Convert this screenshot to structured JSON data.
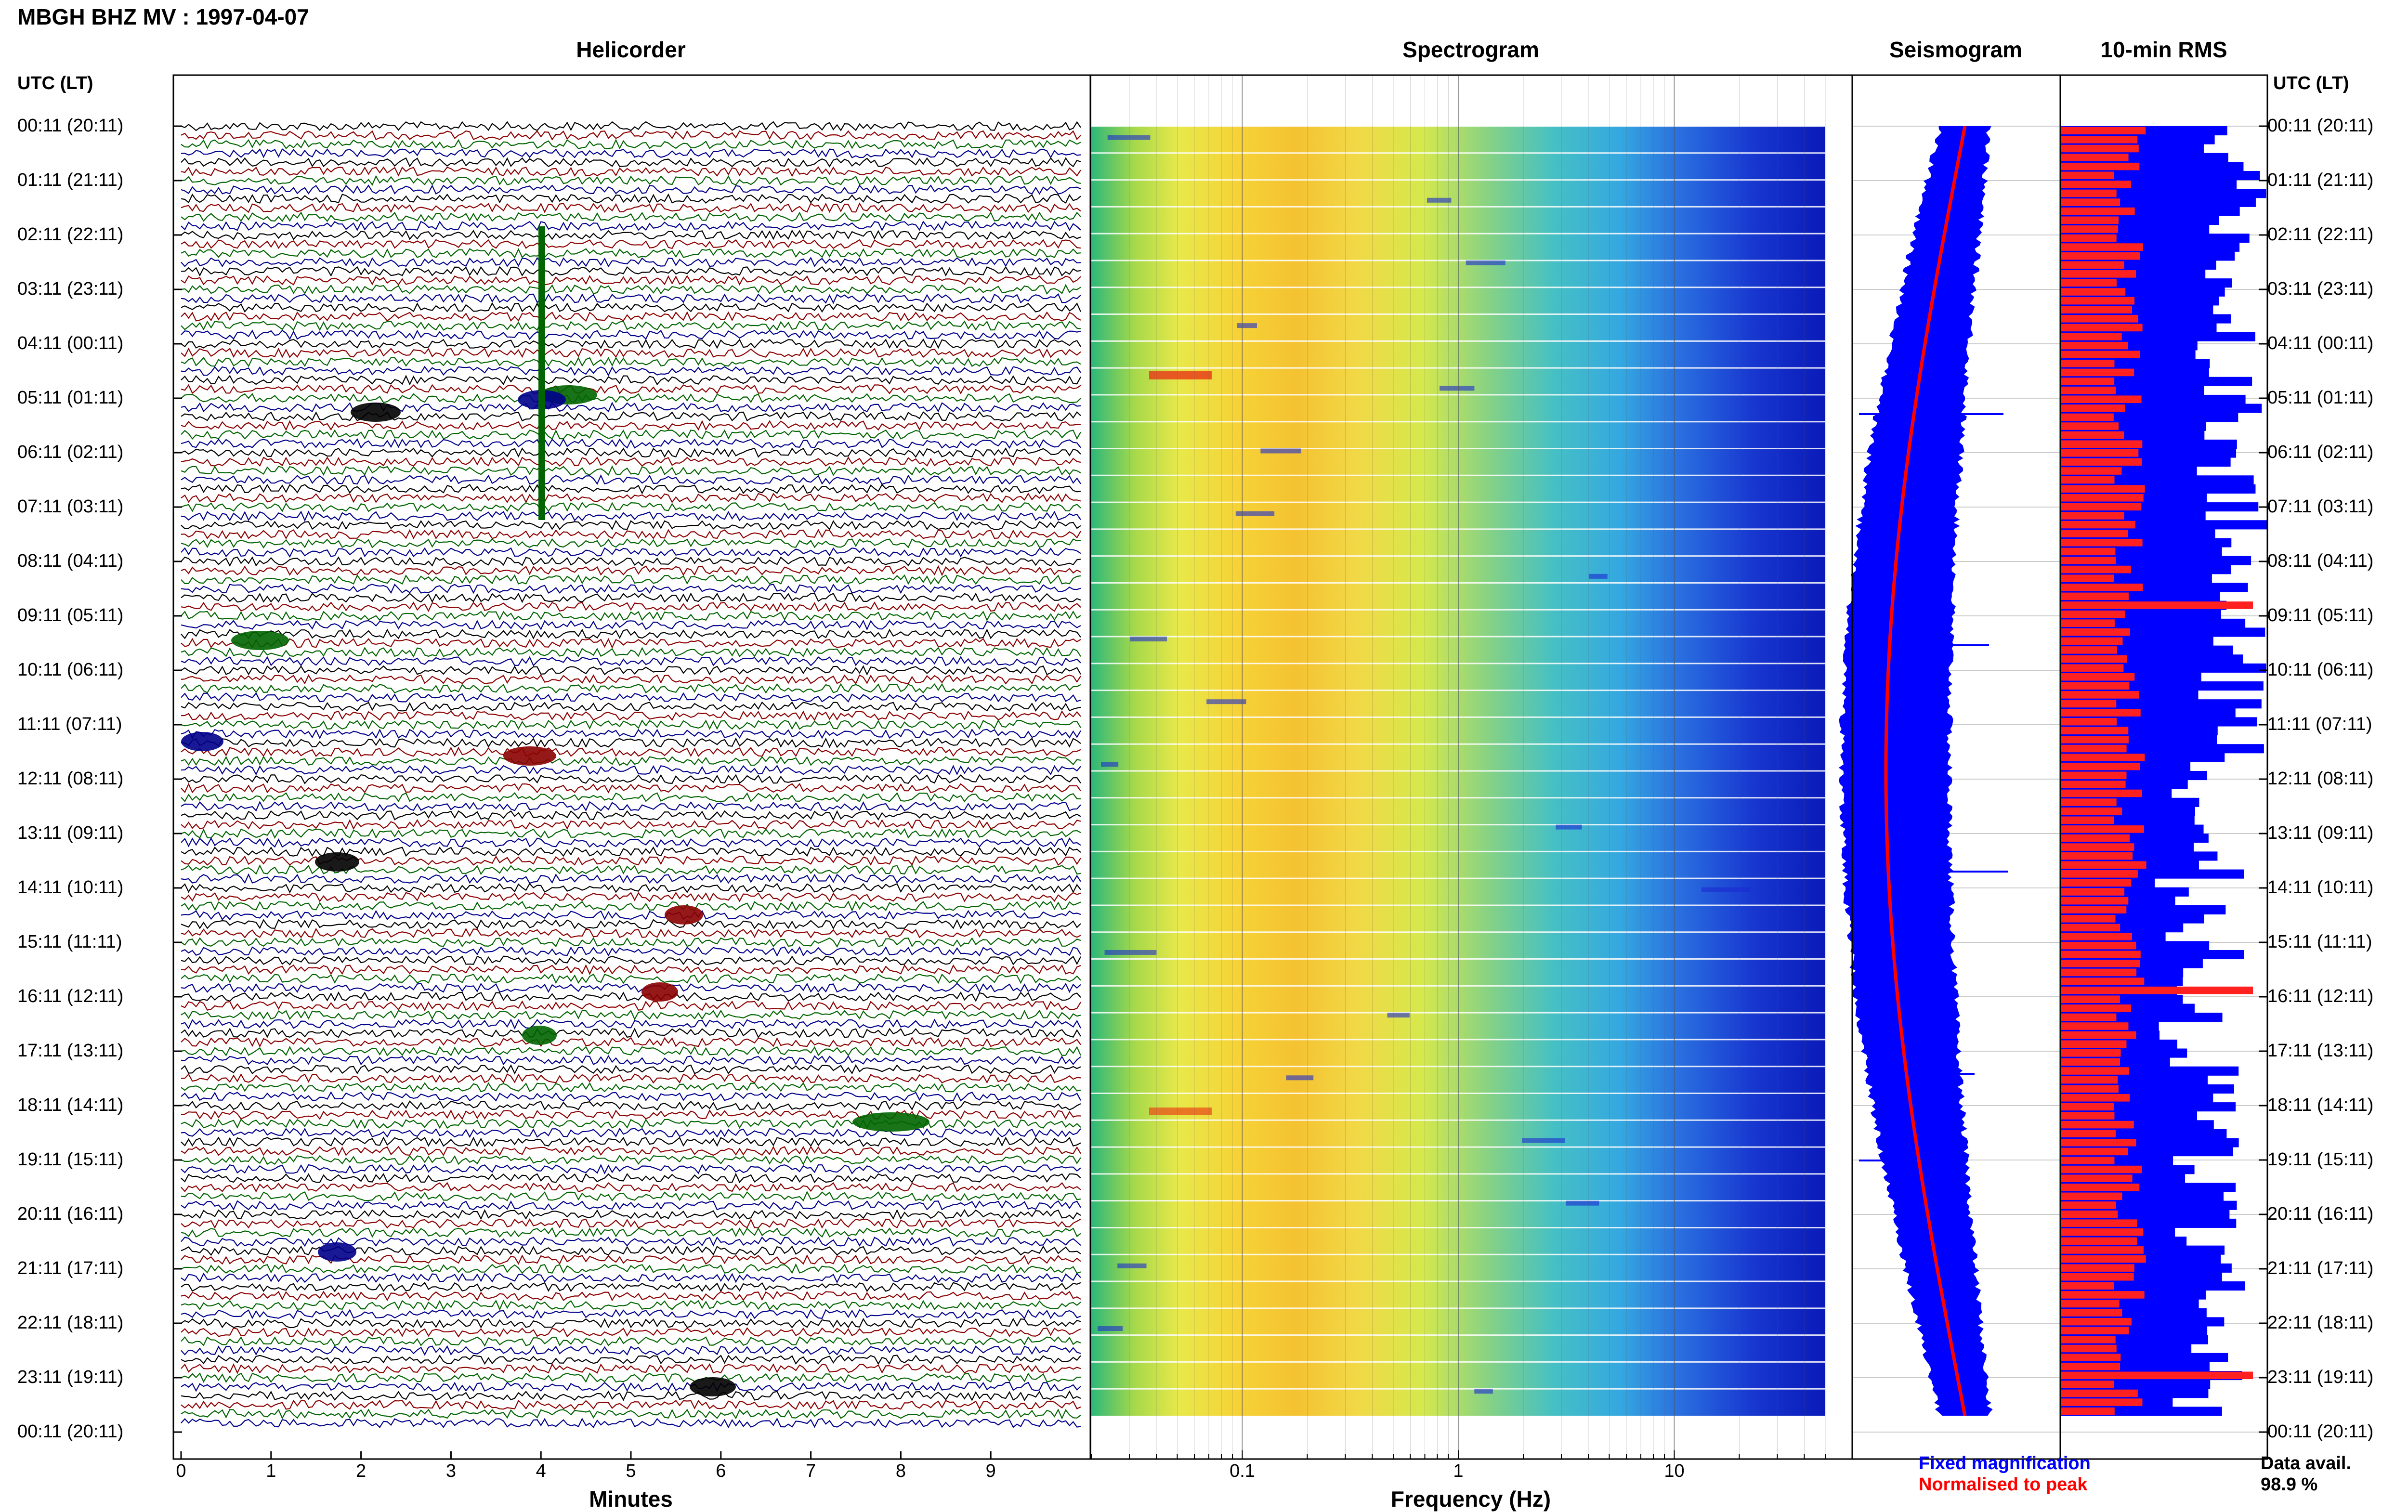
{
  "header": {
    "title": "MBGH BHZ MV : 1997-04-07"
  },
  "panels": {
    "helicorder": {
      "title": "Helicorder",
      "xlabel": "Minutes"
    },
    "spectrogram": {
      "title": "Spectrogram",
      "xlabel": "Frequency (Hz)"
    },
    "seismogram": {
      "title": "Seismogram"
    },
    "rms": {
      "title": "10-min RMS"
    }
  },
  "axis": {
    "left_label": "UTC (LT)",
    "right_label": "UTC (LT)"
  },
  "legend": {
    "fixed": "Fixed magnification",
    "normalised": "Normalised to peak"
  },
  "data_availability": {
    "label": "Data avail.",
    "value": "98.9 %"
  },
  "colors": {
    "trace_colors": [
      "#000000",
      "#cc0000",
      "#00aa00",
      "#0000ff"
    ],
    "helicorder_trace_colors": [
      "#000000",
      "#8b0000",
      "#006400",
      "#00008b"
    ],
    "fixed": "#0000ff",
    "normalised": "#ff0000"
  },
  "chart_data": [
    {
      "type": "line",
      "name": "helicorder",
      "title": "Helicorder",
      "xlabel": "Minutes",
      "xlim": [
        0,
        10
      ],
      "xticks": [
        "0",
        "1",
        "2",
        "3",
        "4",
        "5",
        "6",
        "7",
        "8",
        "9"
      ],
      "y_tick_labels": [
        "00:11 (20:11)",
        "01:11 (21:11)",
        "02:11 (22:11)",
        "03:11 (23:11)",
        "04:11 (00:11)",
        "05:11 (01:11)",
        "06:11 (02:11)",
        "07:11 (03:11)",
        "08:11 (04:11)",
        "09:11 (05:11)",
        "10:11 (06:11)",
        "11:11 (07:11)",
        "12:11 (08:11)",
        "13:11 (09:11)",
        "14:11 (10:11)",
        "15:11 (11:11)",
        "16:11 (12:11)",
        "17:11 (13:11)",
        "18:11 (14:11)",
        "19:11 (15:11)",
        "20:11 (16:11)",
        "21:11 (17:11)",
        "22:11 (18:11)",
        "23:11 (19:11)",
        "00:11 (20:11)"
      ],
      "rows": 144,
      "minutes_per_row": 10
    },
    {
      "type": "heatmap",
      "name": "spectrogram",
      "title": "Spectrogram",
      "xlabel": "Frequency (Hz)",
      "xscale": "log",
      "xlim": [
        0.02,
        50
      ],
      "xticks": [
        "0.1",
        "1",
        "10"
      ]
    },
    {
      "type": "line",
      "name": "seismogram",
      "title": "Seismogram",
      "series": [
        {
          "name": "Fixed magnification",
          "color": "#0000ff"
        },
        {
          "name": "Normalised to peak",
          "color": "#ff0000"
        }
      ]
    },
    {
      "type": "bar",
      "name": "10-min RMS",
      "title": "10-min RMS",
      "series": [
        {
          "name": "Fixed magnification",
          "color": "#0000ff"
        },
        {
          "name": "Normalised to peak",
          "color": "#ff0000"
        }
      ],
      "data_availability_percent": 98.9
    }
  ]
}
